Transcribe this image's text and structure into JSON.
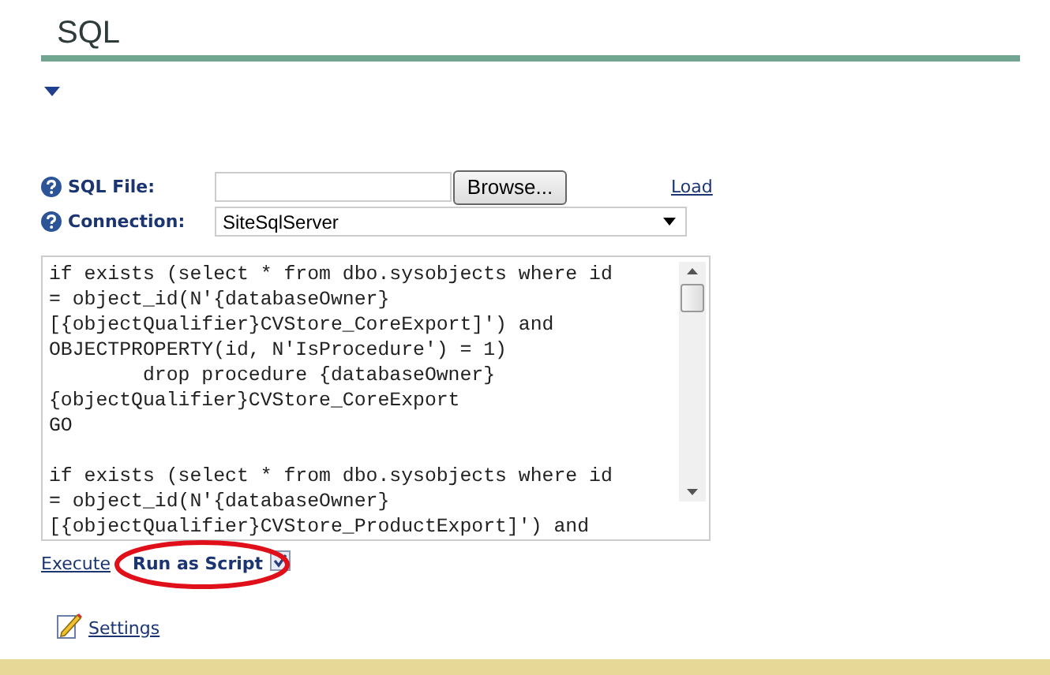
{
  "page": {
    "title": "SQL"
  },
  "form": {
    "fields": [
      {
        "kind": "file",
        "label": "SQL File:",
        "button": "Browse...",
        "link": "Load"
      },
      {
        "kind": "select",
        "label": "Connection:",
        "value": "SiteSqlServer"
      }
    ]
  },
  "editor": {
    "blocks": [
      [
        "if exists (select * from dbo.sysobjects where id",
        "= object_id(N'{databaseOwner}",
        "[{objectQualifier}CVStore_CoreExport]') and",
        "OBJECTPROPERTY(id, N'IsProcedure') = 1)",
        "        drop procedure {databaseOwner}",
        "{objectQualifier}CVStore_CoreExport",
        "GO"
      ],
      [
        "if exists (select * from dbo.sysobjects where id",
        "= object_id(N'{databaseOwner}",
        "[{objectQualifier}CVStore_ProductExport]') and"
      ]
    ]
  },
  "actions": {
    "execute": "Execute",
    "run_as_script": {
      "label": "Run as Script",
      "checked": true,
      "highlighted": true
    }
  },
  "footer": {
    "settings": "Settings"
  }
}
